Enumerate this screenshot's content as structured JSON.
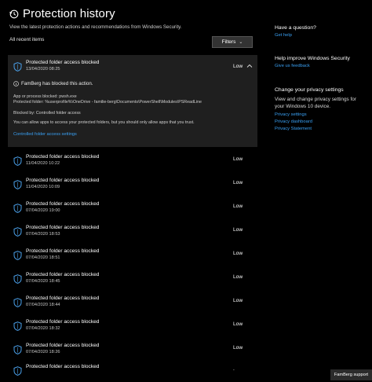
{
  "header": {
    "title": "Protection history",
    "subtitle": "View the latest protection actions and recommendations from Windows Security.",
    "all_recent": "All recent items",
    "filters_label": "Filters"
  },
  "expanded_item": {
    "title": "Protected folder access blocked",
    "date": "13/04/2020 08:25",
    "severity": "Low",
    "info": "FamBerg has blocked this action.",
    "app_blocked": "App or process blocked: pwsh.exe",
    "protected_folder": "Protected folder: %userprofile%\\OneDrive - familie-berg\\Documents\\PowerShell\\Modules\\PSReadLine",
    "blocked_by": "Blocked by: Controlled folder access",
    "allow_text": "You can allow apps to access your protected folders, but you should only allow apps that you trust.",
    "settings_link": "Controlled folder access settings"
  },
  "items": [
    {
      "title": "Protected folder access blocked",
      "date": "11/04/2020 10:22",
      "severity": "Low"
    },
    {
      "title": "Protected folder access blocked",
      "date": "11/04/2020 10:09",
      "severity": "Low"
    },
    {
      "title": "Protected folder access blocked",
      "date": "07/04/2020 19:00",
      "severity": "Low"
    },
    {
      "title": "Protected folder access blocked",
      "date": "07/04/2020 18:53",
      "severity": "Low"
    },
    {
      "title": "Protected folder access blocked",
      "date": "07/04/2020 18:51",
      "severity": "Low"
    },
    {
      "title": "Protected folder access blocked",
      "date": "07/04/2020 18:45",
      "severity": "Low"
    },
    {
      "title": "Protected folder access blocked",
      "date": "07/04/2020 18:44",
      "severity": "Low"
    },
    {
      "title": "Protected folder access blocked",
      "date": "07/04/2020 18:32",
      "severity": "Low"
    },
    {
      "title": "Protected folder access blocked",
      "date": "07/04/2020 18:26",
      "severity": "Low"
    },
    {
      "title": "Protected folder access blocked",
      "date": "",
      "severity": "."
    }
  ],
  "sidebar": {
    "question_head": "Have a question?",
    "get_help": "Get help",
    "improve_head": "Help improve Windows Security",
    "feedback": "Give us feedback",
    "privacy_head": "Change your privacy settings",
    "privacy_text": "View and change privacy settings for your Windows 10 device.",
    "privacy_settings": "Privacy settings",
    "privacy_dashboard": "Privacy dashboard",
    "privacy_statement": "Privacy Statement"
  },
  "support": {
    "label": "FamBerg support"
  },
  "colors": {
    "accent": "#3aa0f3",
    "background": "#000000",
    "panel": "#1f1f1f"
  }
}
